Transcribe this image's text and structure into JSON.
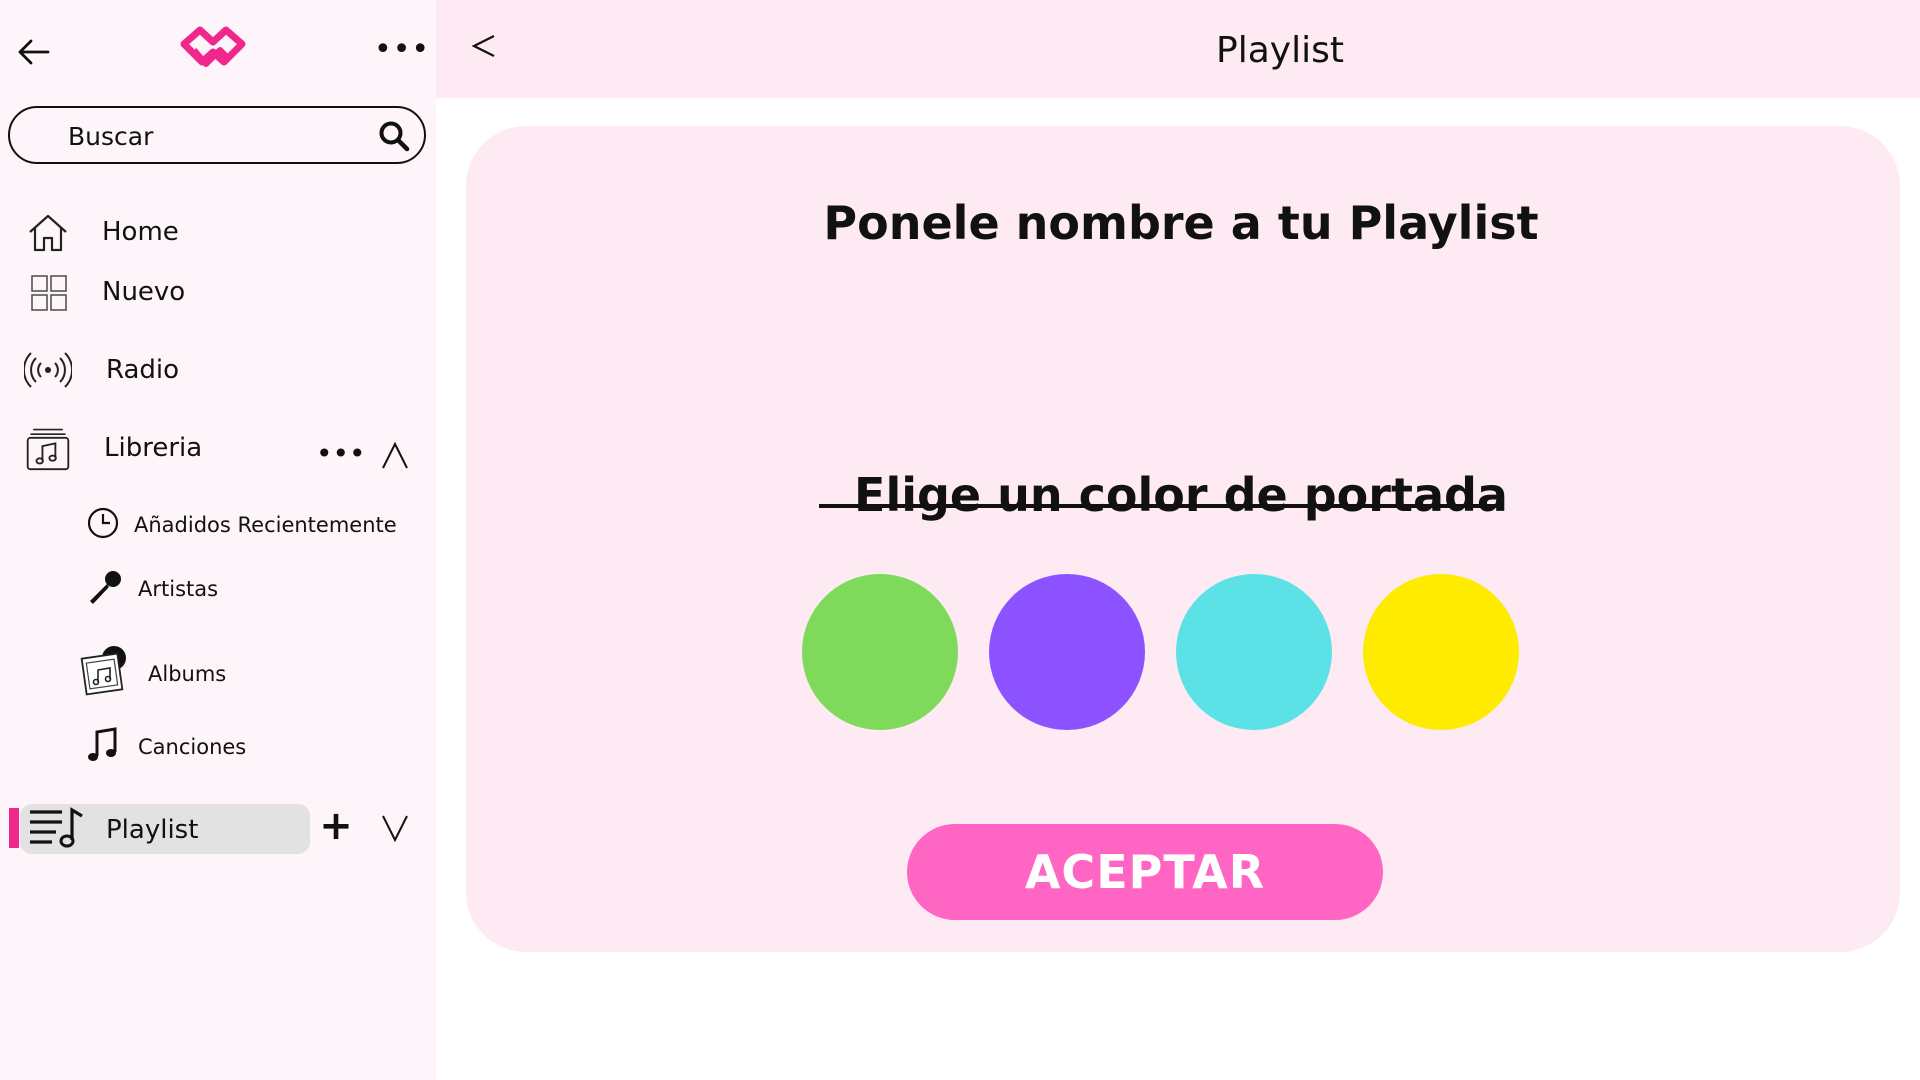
{
  "sidebar": {
    "search": {
      "placeholder": "Buscar"
    },
    "items": [
      {
        "label": "Home",
        "icon": "home-icon"
      },
      {
        "label": "Nuevo",
        "icon": "grid-icon"
      },
      {
        "label": "Radio",
        "icon": "radio-icon"
      },
      {
        "label": "Libreria",
        "icon": "library-icon"
      }
    ],
    "library_sub": [
      {
        "label": "Añadidos Recientemente",
        "icon": "clock-icon"
      },
      {
        "label": "Artistas",
        "icon": "microphone-icon"
      },
      {
        "label": "Albums",
        "icon": "album-icon"
      },
      {
        "label": "Canciones",
        "icon": "music-note-icon"
      }
    ],
    "playlist": {
      "label": "Playlist",
      "icon": "playlist-icon",
      "active": true
    }
  },
  "header": {
    "title": "Playlist"
  },
  "form": {
    "name_heading": "Ponele nombre a tu Playlist",
    "name_value": "",
    "color_heading": "Elige un color de portada",
    "colors": [
      "#7fd95b",
      "#8c52ff",
      "#5ce1e6",
      "#ffeb00"
    ],
    "accept_label": "ACEPTAR"
  },
  "theme": {
    "accent": "#f0288c",
    "button": "#ff66c4",
    "header_bg": "#fdeaf3",
    "sidebar_bg": "#fdf5fa"
  }
}
